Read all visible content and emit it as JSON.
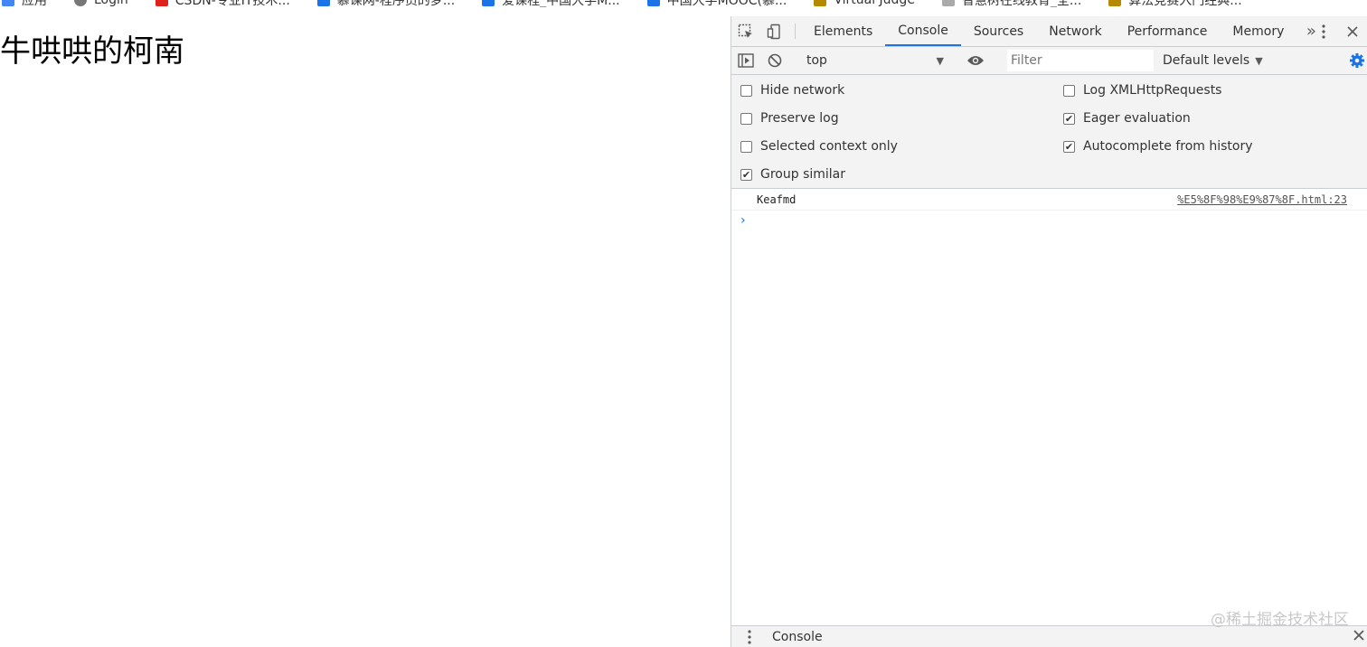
{
  "bookmarks": [
    {
      "label": "应用",
      "icon": "apps-grid-icon",
      "color": "#4285f4"
    },
    {
      "label": "Login",
      "icon": "globe-icon",
      "color": "#777777"
    },
    {
      "label": "CSDN-专业IT技术...",
      "icon": "csdn-logo-icon",
      "color": "#e0201a"
    },
    {
      "label": "慕课网-程序员的梦...",
      "icon": "flag-icon",
      "color": "#1a73e8"
    },
    {
      "label": "爱课程_中国大学M...",
      "icon": "flag-icon",
      "color": "#1a73e8"
    },
    {
      "label": "中国大学MOOC(慕...",
      "icon": "flag-icon",
      "color": "#1a73e8"
    },
    {
      "label": "Virtual Judge",
      "icon": "vj-logo-icon",
      "color": "#b58900"
    },
    {
      "label": "智慧树在线教育_全...",
      "icon": "arrow-icon",
      "color": "#777777"
    },
    {
      "label": "算法竞赛入门经典...",
      "icon": "book-icon",
      "color": "#b58900"
    }
  ],
  "page": {
    "heading": "牛哄哄的柯南"
  },
  "devtools": {
    "tabs": [
      "Elements",
      "Console",
      "Sources",
      "Network",
      "Performance",
      "Memory"
    ],
    "active_tab": "Console",
    "toolbar": {
      "context": "top",
      "filter_placeholder": "Filter",
      "levels": "Default levels"
    },
    "settings": {
      "left": [
        {
          "label": "Hide network",
          "checked": false
        },
        {
          "label": "Preserve log",
          "checked": false
        },
        {
          "label": "Selected context only",
          "checked": false
        },
        {
          "label": "Group similar",
          "checked": true
        }
      ],
      "right": [
        {
          "label": "Log XMLHttpRequests",
          "checked": false
        },
        {
          "label": "Eager evaluation",
          "checked": true
        },
        {
          "label": "Autocomplete from history",
          "checked": true
        }
      ]
    },
    "messages": [
      {
        "text": "Keafmd",
        "source": "%E5%8F%98%E9%87%8F.html:23"
      }
    ],
    "prompt": "›",
    "drawer_label": "Console",
    "accent": "#1a73e8"
  },
  "watermark": "@稀土掘金技术社区"
}
